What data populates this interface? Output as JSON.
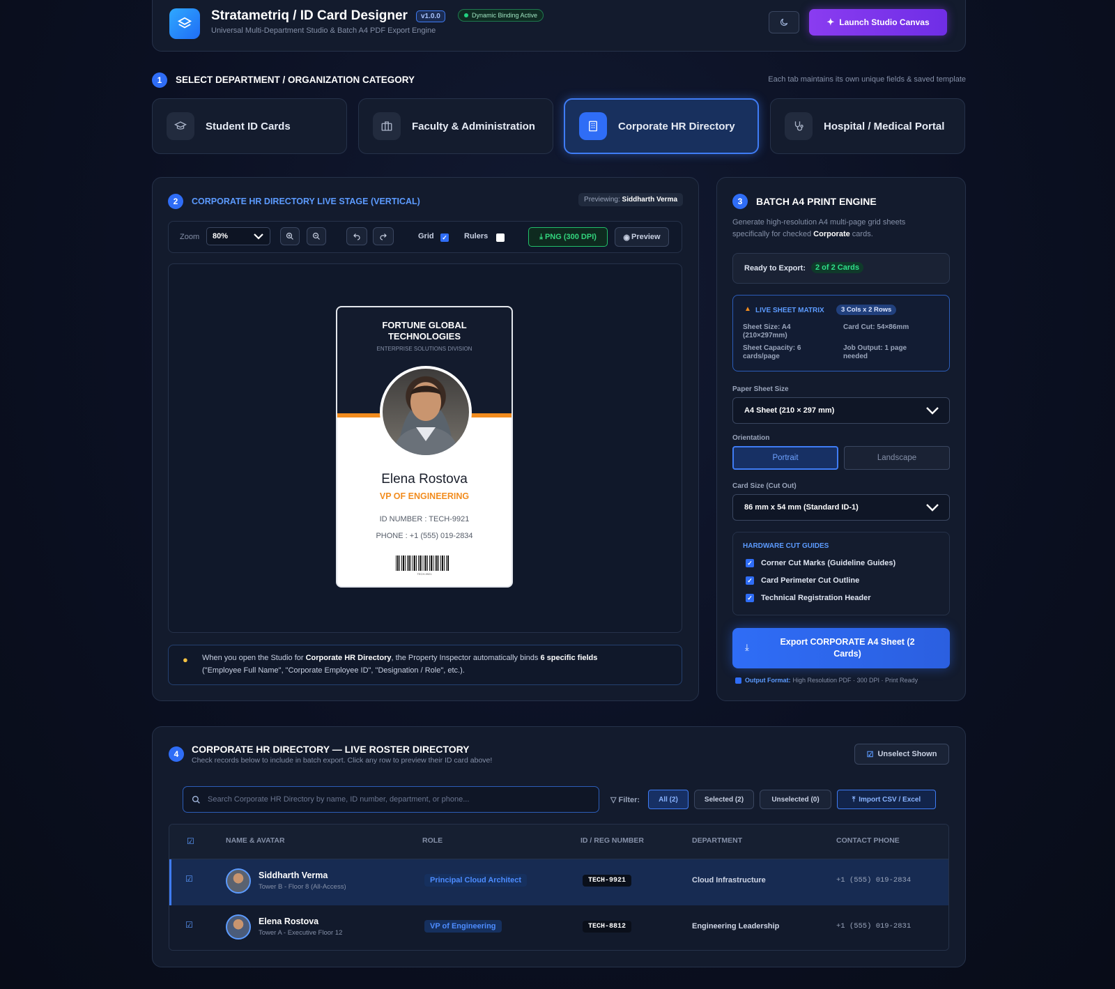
{
  "header": {
    "title": "Stratametriq / ID Card Designer",
    "version": "v1.0.0",
    "status_badge": "Dynamic Binding Active",
    "subtitle": "Universal Multi-Department Studio & Batch A4 PDF Export Engine",
    "theme_toggle_icon": "moon-icon",
    "launch_label": "Launch Studio Canvas"
  },
  "step1": {
    "number": "1",
    "title": "SELECT DEPARTMENT / ORGANIZATION CATEGORY",
    "hint": "Each tab maintains its own unique fields & saved template",
    "tabs": [
      {
        "label": "Student ID Cards",
        "icon": "graduation-cap-icon"
      },
      {
        "label": "Faculty & Administration",
        "icon": "briefcase-icon"
      },
      {
        "label": "Corporate HR Directory",
        "icon": "building-icon"
      },
      {
        "label": "Hospital / Medical Portal",
        "icon": "stethoscope-icon"
      }
    ],
    "active_tab": "Corporate HR Directory"
  },
  "stage": {
    "number": "2",
    "title": "CORPORATE HR DIRECTORY LIVE STAGE (VERTICAL)",
    "previewing_label": "Previewing:",
    "previewing_name": "Siddharth Verma",
    "zoom_label": "Zoom",
    "zoom_value": "80%",
    "grid_label": "Grid",
    "grid_checked": true,
    "rulers_label": "Rulers",
    "rulers_checked": false,
    "png_label": "PNG (300 DPI)",
    "preview_label": "Preview",
    "tip_prefix": "When you open the Studio for ",
    "tip_bold1": "Corporate HR Directory",
    "tip_mid": ", the Property Inspector automatically binds ",
    "tip_bold2": "6 specific fields",
    "tip_line2": "(\"Employee Full Name\", \"Corporate Employee ID\", \"Designation / Role\", etc.)."
  },
  "card": {
    "org_line1": "FORTUNE GLOBAL",
    "org_line2": "TECHNOLOGIES",
    "division": "ENTERPRISE SOLUTIONS DIVISION",
    "name": "Elena Rostova",
    "designation": "VP OF ENGINEERING",
    "id_line": "ID NUMBER : TECH-9921",
    "phone_line": "PHONE : +1 (555) 019-2834",
    "barcode_caption": "TECH-9921",
    "accent_color": "#f28c1e"
  },
  "batch": {
    "number": "3",
    "title": "BATCH A4 PRINT ENGINE",
    "desc_prefix": "Generate high-resolution A4 multi-page grid sheets specifically for checked ",
    "desc_bold": "Corporate",
    "desc_suffix": " cards.",
    "ready_label": "Ready to Export:",
    "ready_value": "2 of 2 Cards",
    "matrix_title": "LIVE SHEET MATRIX",
    "matrix_badge": "3 Cols x 2 Rows",
    "sheet_size_label": "Sheet Size:",
    "sheet_size_value": "A4 (210×297mm)",
    "card_cut_label": "Card Cut:",
    "card_cut_value": "54×86mm",
    "capacity_label": "Sheet Capacity:",
    "capacity_value": "6 cards/page",
    "job_label": "Job Output:",
    "job_value": "1 page needed",
    "paper_label": "Paper Sheet Size",
    "paper_value": "A4 Sheet (210 × 297 mm)",
    "orientation_label": "Orientation",
    "portrait": "Portrait",
    "landscape": "Landscape",
    "cardsize_label": "Card Size (Cut Out)",
    "cardsize_value": "86 mm x 54 mm (Standard ID-1)",
    "guides_title": "HARDWARE CUT GUIDES",
    "guides": [
      "Corner Cut Marks (Guideline Guides)",
      "Card Perimeter Cut Outline",
      "Technical Registration Header"
    ],
    "export_line1": "Export CORPORATE A4 Sheet (2",
    "export_line2": "Cards)",
    "output_label": "Output Format:",
    "output_value": "High Resolution PDF · 300 DPI · Print Ready"
  },
  "roster": {
    "number": "4",
    "title": "CORPORATE HR DIRECTORY — LIVE ROSTER DIRECTORY",
    "subtitle": "Check records below to include in batch export. Click any row to preview their ID card above!",
    "unselect_label": "Unselect Shown",
    "search_placeholder": "Search Corporate HR Directory by name, ID number, department, or phone...",
    "filter_label": "Filter:",
    "filters": [
      "All (2)",
      "Selected (2)",
      "Unselected (0)"
    ],
    "import_label": "Import CSV / Excel",
    "columns": [
      "NAME & AVATAR",
      "ROLE",
      "ID / REG NUMBER",
      "DEPARTMENT",
      "CONTACT PHONE"
    ],
    "rows": [
      {
        "name": "Siddharth Verma",
        "location": "Tower B - Floor 8 (All-Access)",
        "role": "Principal Cloud Architect",
        "id": "TECH-9921",
        "department": "Cloud Infrastructure",
        "phone": "+1 (555) 019-2834"
      },
      {
        "name": "Elena Rostova",
        "location": "Tower A - Executive Floor 12",
        "role": "VP of Engineering",
        "id": "TECH-8812",
        "department": "Engineering Leadership",
        "phone": "+1 (555) 019-2831"
      }
    ]
  }
}
